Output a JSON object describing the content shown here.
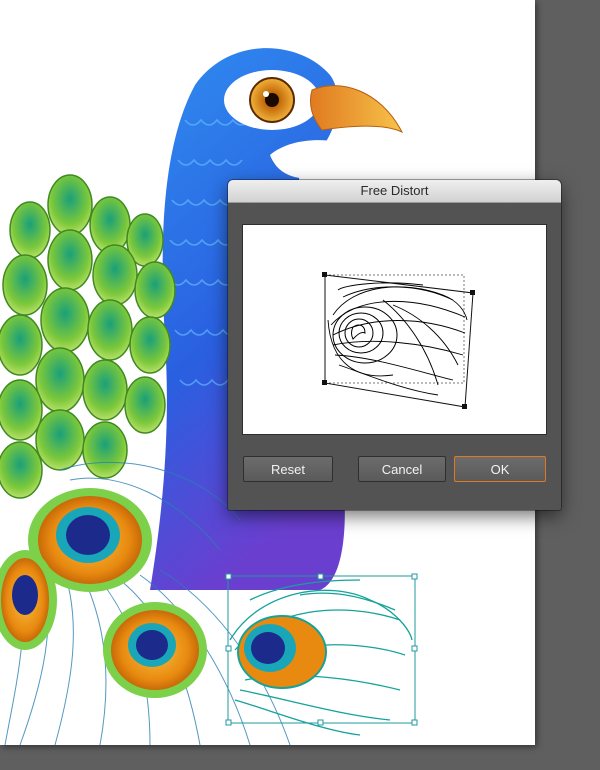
{
  "dialog": {
    "title": "Free Distort",
    "buttons": {
      "reset": "Reset",
      "cancel": "Cancel",
      "ok": "OK"
    }
  },
  "colors": {
    "workspace": "#5f5f5f",
    "dialog_bg": "#535353",
    "ok_focus_ring": "#e07a20",
    "selection_teal": "#1e9aa0"
  },
  "icons": {
    "preview": "feather-wireframe-icon"
  }
}
